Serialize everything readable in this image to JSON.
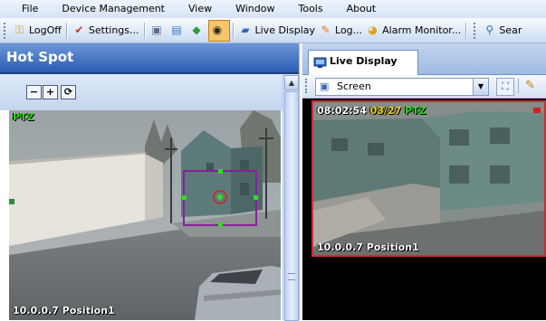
{
  "menubar": {
    "items": [
      "File",
      "Device Management",
      "View",
      "Window",
      "Tools",
      "About"
    ]
  },
  "toolbar": {
    "logoff": "LogOff",
    "settings": "Settings...",
    "live_display": "Live Display",
    "log": "Log...",
    "alarm_monitor": "Alarm Monitor...",
    "search": "Sear"
  },
  "left_panel": {
    "title": "Hot Spot",
    "zoom_out": "−",
    "zoom_in": "+",
    "refresh": "⟳",
    "video": {
      "ptz_label": "PTZ",
      "camera_label": "10.0.0.7  Position1"
    }
  },
  "right_panel": {
    "tab_label": "Live Display",
    "screen_select": "Screen",
    "video": {
      "time": "08:02:54",
      "date": "03/27",
      "ptz_label": "PTZ",
      "camera_label": "10.0.0.7  Position1"
    }
  },
  "colors": {
    "title_bar": "#2a5cb0",
    "active_frame": "#c82f34",
    "ptz_green": "#2ee01a",
    "date_yellow": "#e8d51a",
    "focus_box": "#8a1f9e"
  }
}
